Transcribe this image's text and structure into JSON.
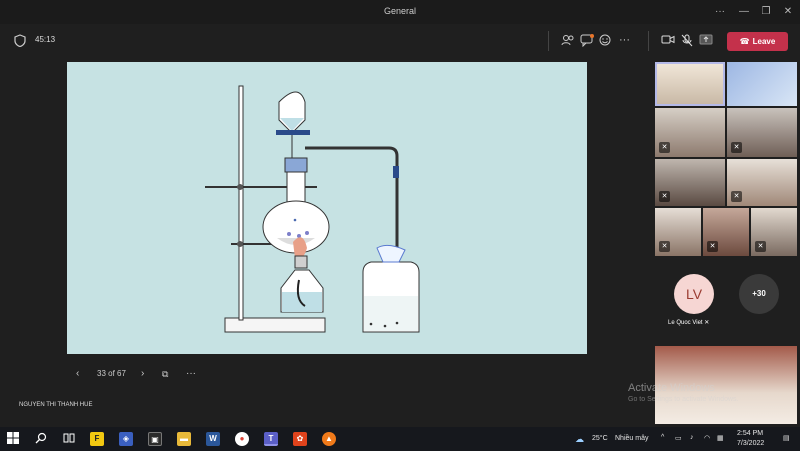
{
  "window": {
    "title": "General"
  },
  "meeting": {
    "timer": "45:13",
    "leave_label": "Leave"
  },
  "presentation": {
    "slide_counter": "33 of 67",
    "presenter": "NGUYEN THI THANH HUE"
  },
  "participants": {
    "avatar_initials": "LV",
    "avatar_name": "Le Quoc Viet",
    "overflow_count": "+30"
  },
  "watermark": {
    "line1": "Activate Windows",
    "line2": "Go to Settings to activate Windows."
  },
  "taskbar": {
    "weather_temp": "25°C",
    "weather_desc": "Nhiều mây",
    "time": "2:54 PM",
    "date": "7/3/2022"
  },
  "colors": {
    "leave": "#c4314b",
    "slide_bg": "#c6e2e3",
    "avatar_bg": "#f6d6d3"
  }
}
